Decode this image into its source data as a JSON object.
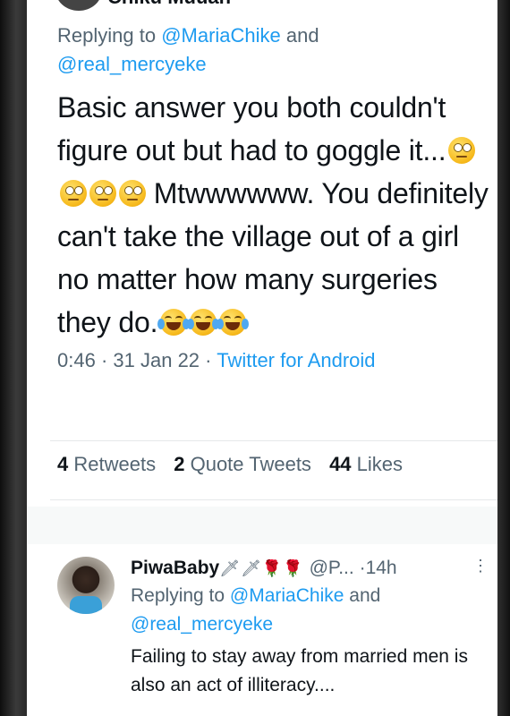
{
  "top_tweet": {
    "author_fragment": "Chiku Muuan",
    "replying_prefix": "Replying to",
    "mention_1": "@MariaChike",
    "and_word": "and",
    "mention_2": "@real_mercyeke",
    "text_part_1": "Basic answer you both couldn't figure out but had to goggle it...",
    "emoji_roll_count": 4,
    "text_part_2": "Mtwwwwww. You definitely can't take the village out of a girl no matter how many surgeries they do.",
    "emoji_laugh_count": 3,
    "time": "0:46",
    "date": "31 Jan 22",
    "sep": "·",
    "source": "Twitter for Android"
  },
  "stats": {
    "retweets_count": "4",
    "retweets_label": "Retweets",
    "quotes_count": "2",
    "quotes_label": "Quote Tweets",
    "likes_count": "44",
    "likes_label": "Likes"
  },
  "reply_tweet": {
    "name": "PiwaBaby",
    "name_icons": "🗡🗡🌹🌹",
    "handle": "@P...",
    "sep": "·",
    "time": "14h",
    "more_icon": "more-vertical-icon",
    "replying_prefix": "Replying to",
    "mention_1": "@MariaChike",
    "and_word": "and",
    "mention_2": "@real_mercyeke",
    "text": "Failing to stay away from married men is also an act of illiteracy...."
  },
  "colors": {
    "accent": "#1d9bf0",
    "text": "#0f1419",
    "muted": "#536471"
  }
}
